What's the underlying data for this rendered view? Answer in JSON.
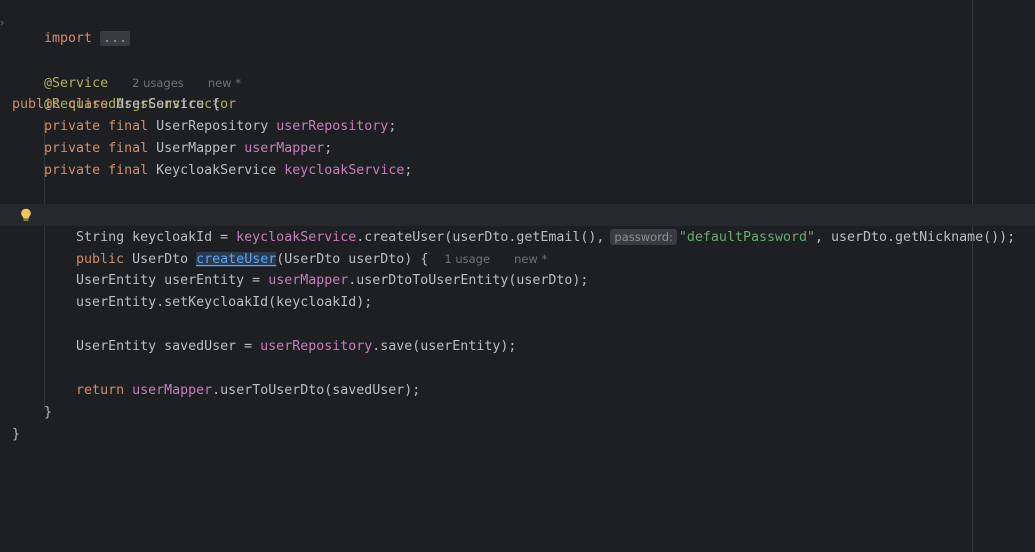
{
  "editor": {
    "fold_marker": "›",
    "lines": {
      "l1": {
        "import_kw": "import",
        "folded": "..."
      },
      "l3": {
        "annotation": "@Service",
        "usages": "2 usages",
        "status": "new *"
      },
      "l4": {
        "annotation": "@RequiredArgsConstructor"
      },
      "l5": {
        "kw_public": "public",
        "kw_class": "class",
        "name": "UserService",
        "brace": " {"
      },
      "l6": {
        "kw_private": "private",
        "kw_final": "final",
        "type": "UserRepository",
        "field": "userRepository",
        "semi": ";"
      },
      "l7": {
        "kw_private": "private",
        "kw_final": "final",
        "type": "UserMapper",
        "field": "userMapper",
        "semi": ";"
      },
      "l8": {
        "kw_private": "private",
        "kw_final": "final",
        "type": "KeycloakService",
        "field": "keycloakService",
        "semi": ";"
      },
      "l10": {
        "kw_public": "public",
        "ret_type": "UserDto",
        "method": "createUser",
        "params": "(UserDto userDto) {",
        "usages": "1 usage",
        "status": "new *"
      },
      "l11": {
        "pre": "String keycloakId = ",
        "field": "keycloakService",
        "call": ".createUser(userDto.getEmail(),",
        "param_hint": "password:",
        "str": "\"defaultPassword\"",
        "post": ", userDto.getNickname());"
      },
      "l13": {
        "pre": "UserEntity userEntity = ",
        "field": "userMapper",
        "post": ".userDtoToUserEntity(userDto);"
      },
      "l14": {
        "text": "userEntity.setKeycloakId(keycloakId);"
      },
      "l16": {
        "pre": "UserEntity savedUser = ",
        "field": "userRepository",
        "post": ".save(userEntity);"
      },
      "l18": {
        "kw_return": "return",
        "field": "userMapper",
        "post": ".userToUserDto(savedUser);"
      },
      "l19": {
        "text": "}"
      },
      "l20": {
        "text": "}"
      }
    }
  },
  "colors": {
    "background": "#1e1f22",
    "keyword": "#cf8e6d",
    "annotation": "#b3ae60",
    "field": "#c77dbb",
    "string": "#6aab73",
    "method_declaration": "#56a8f5",
    "default_text": "#bcbec4",
    "hint": "#6f737a"
  },
  "icons": {
    "gutter": "lightbulb-icon"
  }
}
